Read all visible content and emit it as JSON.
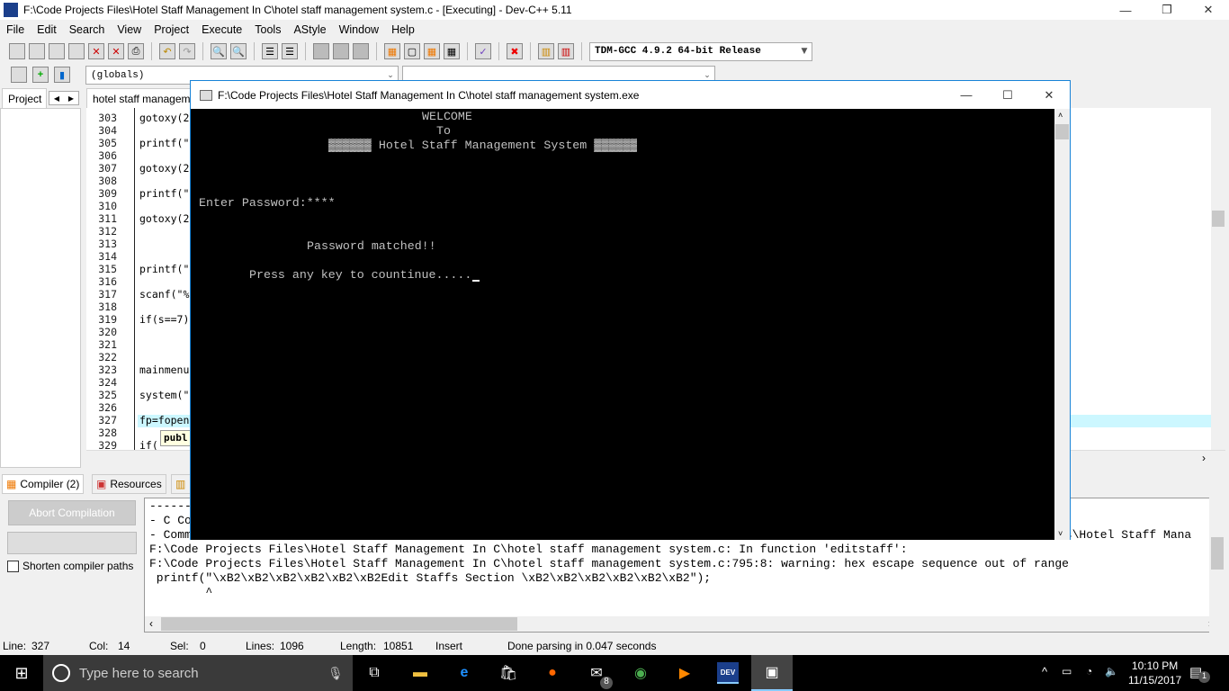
{
  "window": {
    "title": "F:\\Code Projects Files\\Hotel Staff Management In C\\hotel staff management system.c - [Executing] - Dev-C++ 5.11",
    "icon": "DEV"
  },
  "menu": [
    "File",
    "Edit",
    "Search",
    "View",
    "Project",
    "Execute",
    "Tools",
    "AStyle",
    "Window",
    "Help"
  ],
  "toolbar": {
    "compiler_select": "TDM-GCC 4.9.2 64-bit Release",
    "scope_select": "(globals)"
  },
  "tabs": {
    "project": "Project",
    "editor": "hotel staff managem"
  },
  "editor": {
    "line_numbers": [
      "303",
      "304",
      "305",
      "306",
      "307",
      "308",
      "309",
      "310",
      "311",
      "312",
      "313",
      "314",
      "315",
      "316",
      "317",
      "318",
      "319",
      "320",
      "321",
      "322",
      "323",
      "324",
      "325",
      "326",
      "327",
      "328",
      "329"
    ],
    "code": [
      {
        "line": "303",
        "text": "gotoxy(2"
      },
      {
        "line": "305",
        "text": "printf(\""
      },
      {
        "line": "307",
        "text": "gotoxy(2"
      },
      {
        "line": "309",
        "text": "printf(\""
      },
      {
        "line": "311",
        "text": "gotoxy(2"
      },
      {
        "line": "315",
        "text": "printf(\""
      },
      {
        "line": "317",
        "text": "scanf(\"%"
      },
      {
        "line": "319",
        "text": "if(s==7)"
      },
      {
        "line": "323",
        "text": "mainmenu"
      },
      {
        "line": "325",
        "text": "system(\""
      },
      {
        "line": "327",
        "text": "fp=fopen"
      },
      {
        "line": "329",
        "text": "if("
      }
    ],
    "tooltip": "publ"
  },
  "console": {
    "title": "F:\\Code Projects Files\\Hotel Staff Management In C\\hotel staff management system.exe",
    "lines": [
      "WELCOME",
      "To",
      "▓▓▓▓▓▓ Hotel Staff Management System ▓▓▓▓▓▓",
      "Enter Password:****",
      "Password matched!!",
      "Press any key to countinue....."
    ]
  },
  "bottom_tabs": [
    "Compiler (2)",
    "Resources"
  ],
  "compiler": {
    "abort_label": "Abort Compilation",
    "shorten_label": "Shorten compiler paths",
    "shorten_checked": false
  },
  "output": [
    "-------",
    "- C Co",
    "- Comm",
    "F:\\Code Projects Files\\Hotel Staff Management In C\\hotel staff management system.c: In function 'editstaff':",
    "F:\\Code Projects Files\\Hotel Staff Management In C\\hotel staff management system.c:795:8: warning: hex escape sequence out of range",
    " printf(\"\\xB2\\xB2\\xB2\\xB2\\xB2\\xB2Edit Staffs Section \\xB2\\xB2\\xB2\\xB2\\xB2\\xB2\");",
    "        ^"
  ],
  "output_right": "es\\Hotel Staff Mana",
  "status": {
    "line_label": "Line:",
    "line": "327",
    "col_label": "Col:",
    "col": "14",
    "sel_label": "Sel:",
    "sel": "0",
    "lines_label": "Lines:",
    "lines": "1096",
    "length_label": "Length:",
    "length": "10851",
    "mode": "Insert",
    "message": "Done parsing in 0.047 seconds"
  },
  "taskbar": {
    "search_placeholder": "Type here to search",
    "time": "10:10 PM",
    "date": "11/15/2017",
    "mail_badge": "8",
    "notif_badge": "1"
  }
}
